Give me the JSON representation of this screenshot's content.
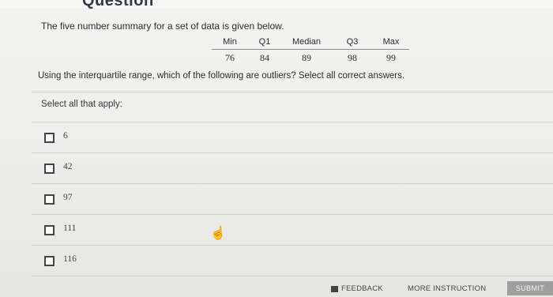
{
  "question": {
    "heading_fragment": "Question",
    "prompt": "The five number summary for a set of data is given below.",
    "summary_headers": [
      "Min",
      "Q1",
      "Median",
      "Q3",
      "Max"
    ],
    "summary_values": [
      "76",
      "84",
      "89",
      "98",
      "99"
    ],
    "instruction": "Using the interquartile range, which of the following are outliers? Select all correct answers."
  },
  "answers": {
    "select_label": "Select all that apply:",
    "options": [
      "6",
      "42",
      "97",
      "111",
      "116"
    ]
  },
  "footer": {
    "feedback_label": "FEEDBACK",
    "more_instruction_label": "MORE INSTRUCTION",
    "submit_label": "SUBMIT"
  }
}
